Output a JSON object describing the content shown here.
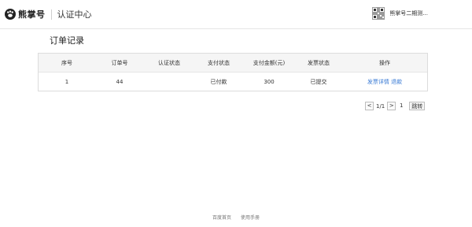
{
  "header": {
    "brand": "熊掌号",
    "subtitle": "认证中心",
    "user_name": "熊掌号二期测..."
  },
  "page": {
    "title": "订单记录"
  },
  "table": {
    "columns": [
      "序号",
      "订单号",
      "认证状态",
      "支付状态",
      "支付金额(元)",
      "发票状态",
      "操作"
    ],
    "rows": [
      {
        "index": "1",
        "order_no": "44",
        "auth_status": "",
        "pay_status": "已付款",
        "amount": "300",
        "invoice_status": "已提交",
        "action_detail": "发票详情",
        "action_refund": "退款"
      }
    ]
  },
  "pagination": {
    "prev": "<",
    "page_text": "1/1",
    "next": ">",
    "input_value": "1",
    "jump": "跳转"
  },
  "footer": {
    "links": [
      "百度首页",
      "使用手册"
    ],
    "copyright": ""
  }
}
